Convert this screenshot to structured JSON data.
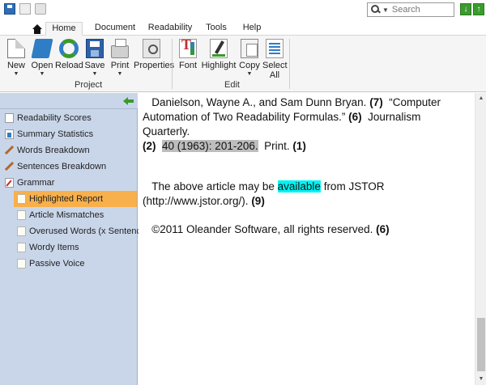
{
  "quick_access": {
    "save_icon": "save-icon",
    "copy_icon": "copy-icon",
    "print_icon": "print-icon"
  },
  "search": {
    "placeholder": "Search",
    "value": ""
  },
  "tabs": [
    {
      "label": "Home",
      "active": true
    },
    {
      "label": "Document"
    },
    {
      "label": "Readability"
    },
    {
      "label": "Tools"
    },
    {
      "label": "Help"
    }
  ],
  "ribbon": {
    "project_buttons": [
      {
        "label": "New"
      },
      {
        "label": "Open"
      },
      {
        "label": "Reload"
      },
      {
        "label": "Save"
      },
      {
        "label": "Print"
      },
      {
        "label": "Properties"
      }
    ],
    "project_group_label": "Project",
    "edit_buttons": [
      {
        "label": "Font"
      },
      {
        "label": "Highlight"
      },
      {
        "label": "Copy"
      },
      {
        "label": "Select",
        "label2": "All"
      }
    ],
    "edit_group_label": "Edit"
  },
  "sidebar": {
    "items": [
      {
        "label": "Readability Scores"
      },
      {
        "label": "Summary Statistics"
      },
      {
        "label": "Words Breakdown"
      },
      {
        "label": "Sentences Breakdown"
      },
      {
        "label": "Grammar"
      },
      {
        "label": "Highlighted Report",
        "selected": true
      },
      {
        "label": "Article Mismatches"
      },
      {
        "label": "Overused Words (x Sentence)"
      },
      {
        "label": "Wordy Items"
      },
      {
        "label": "Passive Voice"
      }
    ]
  },
  "content": {
    "para1": {
      "a": "Danielson, Wayne A., and Sam Dunn Bryan.",
      "a_count": "(7)",
      "b": "“Computer Automation of Two Readability Formulas.”",
      "b_count": "(6)",
      "c": "Journalism Quarterly.",
      "c_count": "(2)",
      "d": "40 (1963): 201-206.",
      "e": "Print.",
      "e_count": "(1)"
    },
    "para2": {
      "a": "The above article may be",
      "highlight": "available",
      "b": "from JSTOR (http://www.jstor.org/).",
      "count": "(9)"
    },
    "para3": {
      "text": "©2011 Oleander Software, all rights reserved.",
      "count": "(6)"
    }
  },
  "colors": {
    "selected_item": "#f7b04b",
    "sidebar_bg": "#c9d6ea",
    "highlight_cyan": "#00f4f4",
    "highlight_gray": "#bdbdbd"
  }
}
